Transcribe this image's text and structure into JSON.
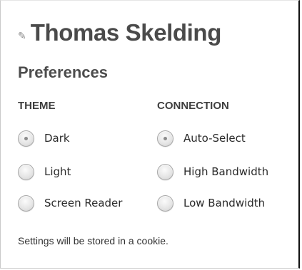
{
  "header": {
    "edit_icon": "pencil-icon",
    "user_name": "Thomas Skelding"
  },
  "preferences": {
    "title": "Preferences",
    "theme": {
      "heading": "THEME",
      "options": [
        {
          "label": "Dark",
          "selected": true
        },
        {
          "label": "Light",
          "selected": false
        },
        {
          "label": "Screen Reader",
          "selected": false
        }
      ]
    },
    "connection": {
      "heading": "CONNECTION",
      "options": [
        {
          "label": "Auto-Select",
          "selected": true
        },
        {
          "label": "High Bandwidth",
          "selected": false
        },
        {
          "label": "Low Bandwidth",
          "selected": false
        }
      ]
    },
    "note": "Settings will be stored in a cookie."
  }
}
